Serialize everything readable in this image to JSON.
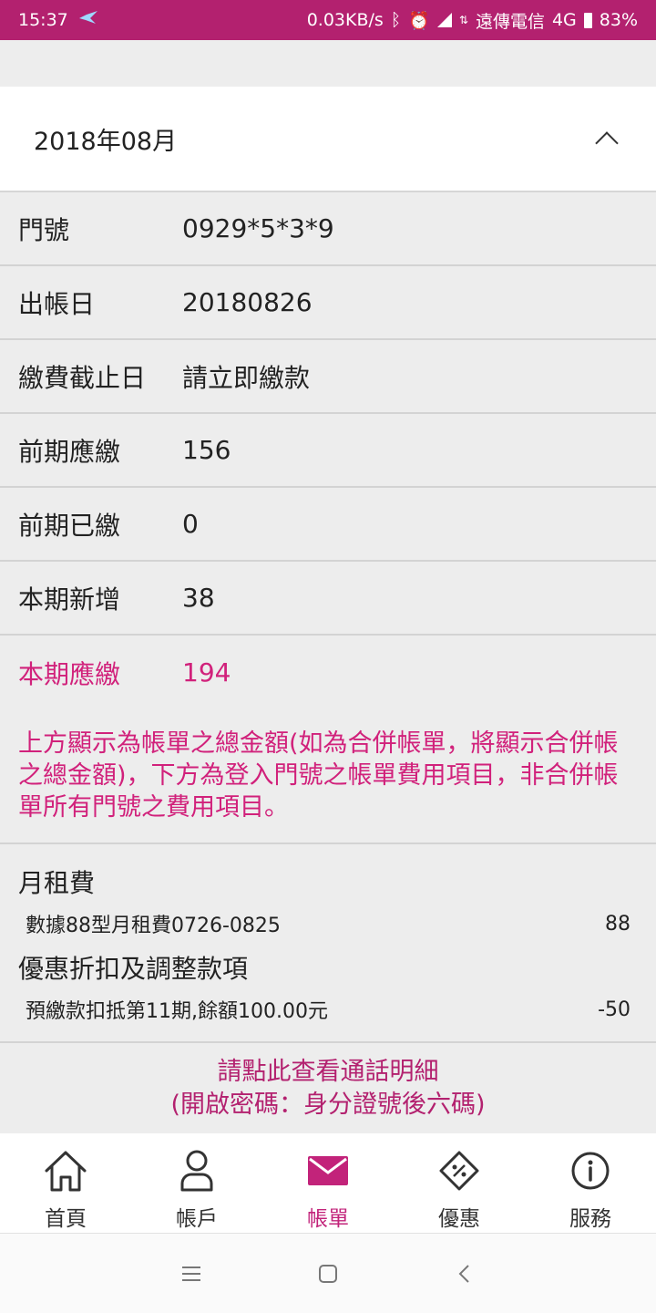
{
  "status_bar": {
    "time": "15:37",
    "speed": "0.03KB/s",
    "carrier": "遠傳電信",
    "network": "4G",
    "battery": "83%"
  },
  "bill": {
    "month": "2018年08月",
    "rows": [
      {
        "label": "門號",
        "value": "0929*5*3*9"
      },
      {
        "label": "出帳日",
        "value": "20180826"
      },
      {
        "label": "繳費截止日",
        "value": "請立即繳款"
      },
      {
        "label": "前期應繳",
        "value": "156"
      },
      {
        "label": "前期已繳",
        "value": "0"
      },
      {
        "label": "本期新增",
        "value": "38"
      },
      {
        "label": "本期應繳",
        "value": "194"
      }
    ],
    "notice": "上方顯示為帳單之總金額(如為合併帳單，將顯示合併帳之總金額)，下方為登入門號之帳單費用項目，非合併帳單所有門號之費用項目。"
  },
  "fees": [
    {
      "category": "月租費",
      "item": "數據88型月租費0726-0825",
      "amount": "88"
    },
    {
      "category": "優惠折扣及調整款項",
      "item": "預繳款扣抵第11期,餘額100.00元",
      "amount": "-50"
    }
  ],
  "detail_link": {
    "line1": "請點此查看通話明細",
    "line2": "(開啟密碼：身分證號後六碼)"
  },
  "nav": [
    {
      "label": "首頁",
      "icon": "home-icon"
    },
    {
      "label": "帳戶",
      "icon": "user-icon"
    },
    {
      "label": "帳單",
      "icon": "mail-icon",
      "active": true
    },
    {
      "label": "優惠",
      "icon": "discount-tag-icon"
    },
    {
      "label": "服務",
      "icon": "info-icon"
    }
  ],
  "colors": {
    "brand": "#b3216f",
    "highlight": "#d1217b"
  }
}
